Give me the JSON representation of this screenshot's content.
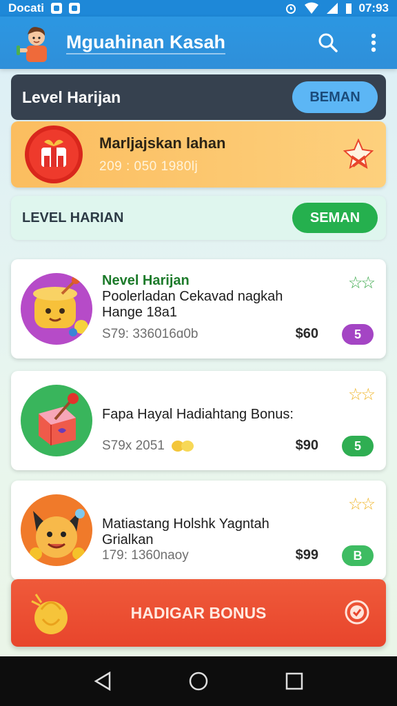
{
  "status_bar": {
    "left_text": "Docati",
    "time": "07:93"
  },
  "app_bar": {
    "title": "Mguahinan Kasah",
    "icons": [
      "avatar",
      "search-icon",
      "more-vert-icon"
    ]
  },
  "level_dark": {
    "label": "Level Harijan",
    "button": "BEMAN"
  },
  "promo": {
    "title": "Marljajskan lahan",
    "subtitle": "209 : 050 1980lj",
    "icon": "ribbon-icon"
  },
  "level_light": {
    "label": "LEVEL HARIAN",
    "button": "SEMAN"
  },
  "items": [
    {
      "tag": "Nevel Harijan",
      "title_line1": "Poolerladan Cekavad nagkah",
      "title_line2": "Hange 18a1",
      "meta": "S79: 336016ɑ0b",
      "price": "$60",
      "badge": "5",
      "badge_color": "#a445c4",
      "star_color": "#3aa84a"
    },
    {
      "tag": "",
      "title_line1": "Fapa Hayal Hadiahtang Bonus:",
      "title_line2": "",
      "meta": "S79x 2051",
      "price": "$90",
      "badge": "5",
      "badge_color": "#2fae52",
      "star_color": "#efb426"
    },
    {
      "tag": "",
      "title_line1": "Matiastang Holshk Yagntah",
      "title_line2": "Grialkan",
      "meta": "179: 1360naoy",
      "price": "$99",
      "badge": "B",
      "badge_color": "#3ebc62",
      "star_color": "#efb426"
    }
  ],
  "bonus": {
    "label": "HADIGAR BONUS"
  },
  "colors": {
    "app_bar": "#2c97e2",
    "promo": "#fbbd5f",
    "bonus": "#e8452c",
    "dark": "#36414f"
  }
}
